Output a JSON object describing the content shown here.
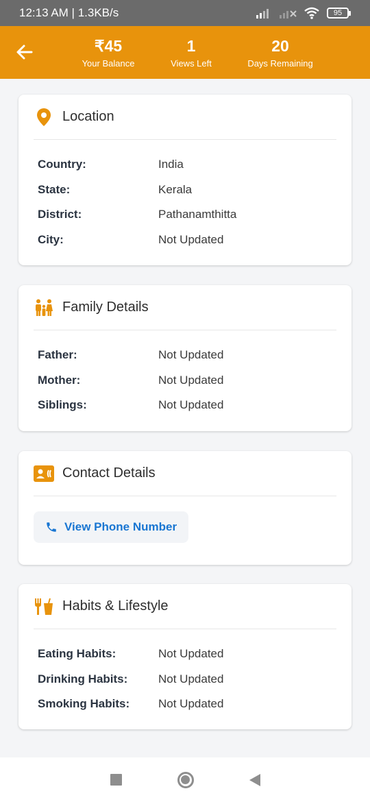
{
  "status_bar": {
    "time_speed": "12:13 AM | 1.3KB/s",
    "battery": "95"
  },
  "header": {
    "stats": [
      {
        "value": "₹45",
        "label": "Your Balance"
      },
      {
        "value": "1",
        "label": "Views Left"
      },
      {
        "value": "20",
        "label": "Days Remaining"
      }
    ]
  },
  "location": {
    "title": "Location",
    "rows": [
      {
        "label": "Country:",
        "value": "India"
      },
      {
        "label": "State:",
        "value": "Kerala"
      },
      {
        "label": "District:",
        "value": "Pathanamthitta"
      },
      {
        "label": "City:",
        "value": "Not Updated"
      }
    ]
  },
  "family": {
    "title": "Family Details",
    "rows": [
      {
        "label": "Father:",
        "value": "Not Updated"
      },
      {
        "label": "Mother:",
        "value": "Not Updated"
      },
      {
        "label": "Siblings:",
        "value": "Not Updated"
      }
    ]
  },
  "contact": {
    "title": "Contact Details",
    "phone_button": "View Phone Number"
  },
  "habits": {
    "title": "Habits & Lifestyle",
    "rows": [
      {
        "label": "Eating Habits:",
        "value": "Not Updated"
      },
      {
        "label": "Drinking Habits:",
        "value": "Not Updated"
      },
      {
        "label": "Smoking Habits:",
        "value": "Not Updated"
      }
    ]
  },
  "colors": {
    "accent": "#e8930c",
    "link": "#1976d2",
    "status_bar": "#6b6b6b"
  },
  "icons": {
    "location": "map-pin-icon",
    "family": "family-icon",
    "contact": "contact-card-icon",
    "habits": "fork-drink-icon",
    "phone": "phone-icon",
    "back": "arrow-left-icon"
  }
}
